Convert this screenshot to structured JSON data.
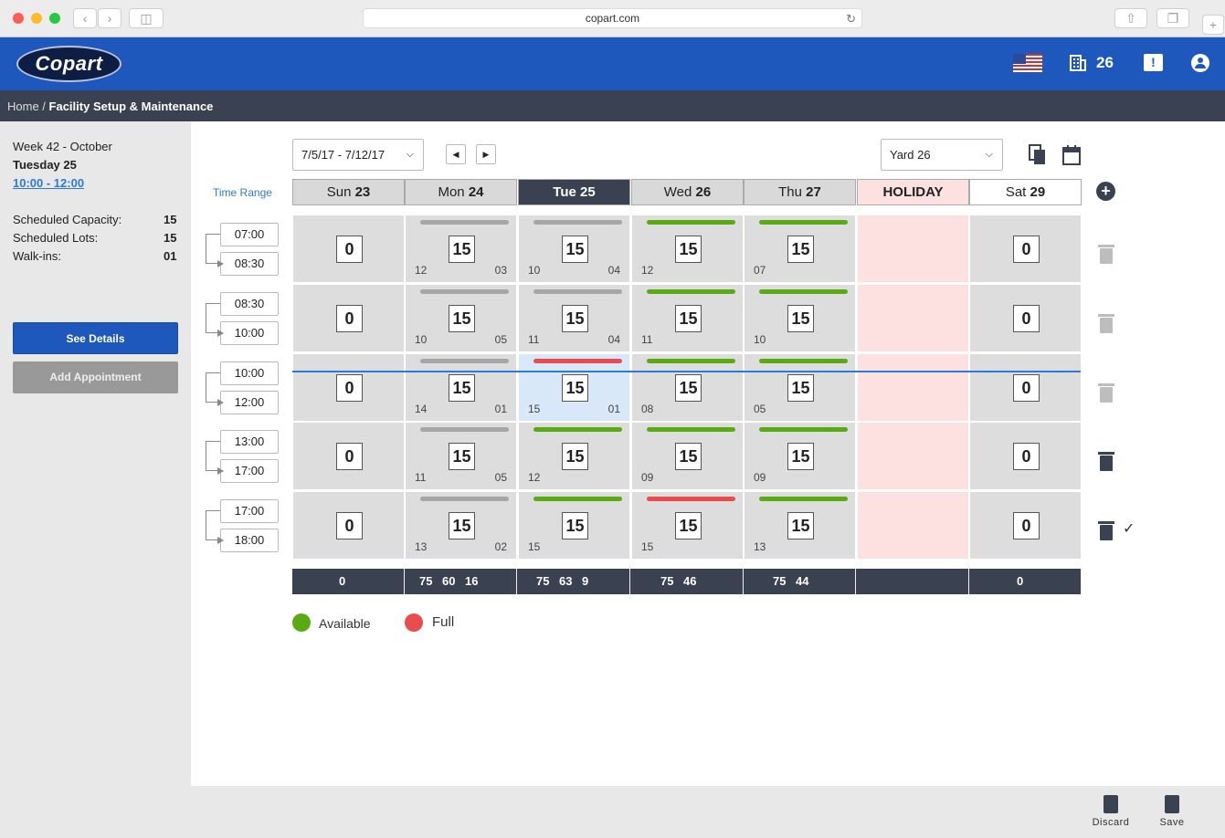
{
  "browser": {
    "url": "copart.com"
  },
  "header": {
    "logo": "Copart",
    "yard_count": "26"
  },
  "breadcrumb": {
    "home": "Home",
    "sep": " / ",
    "current": "Facility Setup & Maintenance"
  },
  "sidebar": {
    "week": "Week 42 - October",
    "day": "Tuesday 25",
    "range": "10:00 - 12:00",
    "stats": [
      {
        "label": "Scheduled Capacity:",
        "value": "15"
      },
      {
        "label": "Scheduled Lots:",
        "value": "15"
      },
      {
        "label": "Walk-ins:",
        "value": "01"
      }
    ],
    "see_details": "See Details",
    "add_appointment": "Add Appointment"
  },
  "toolbar": {
    "date_range": "7/5/17 - 7/12/17",
    "yard": "Yard 26",
    "time_range_label": "Time Range"
  },
  "days": [
    {
      "name": "Sun",
      "num": "23",
      "style": "normal"
    },
    {
      "name": "Mon",
      "num": "24",
      "style": "normal"
    },
    {
      "name": "Tue",
      "num": "25",
      "style": "selected"
    },
    {
      "name": "Wed",
      "num": "26",
      "style": "normal"
    },
    {
      "name": "Thu",
      "num": "27",
      "style": "normal"
    },
    {
      "name": "HOLIDAY",
      "num": "",
      "style": "holiday"
    },
    {
      "name": "Sat",
      "num": "29",
      "style": "white"
    }
  ],
  "slots": [
    {
      "start": "07:00",
      "end": "08:30",
      "trash": "light",
      "check": false,
      "cells": [
        {
          "cap": "0"
        },
        {
          "cap": "15",
          "bar": "grey",
          "l": "12",
          "r": "03"
        },
        {
          "cap": "15",
          "bar": "grey",
          "l": "10",
          "r": "04"
        },
        {
          "cap": "15",
          "bar": "green",
          "l": "12",
          "r": ""
        },
        {
          "cap": "15",
          "bar": "green",
          "l": "07",
          "r": ""
        },
        {
          "holiday": true
        },
        {
          "cap": "0"
        }
      ]
    },
    {
      "start": "08:30",
      "end": "10:00",
      "trash": "light",
      "check": false,
      "cells": [
        {
          "cap": "0"
        },
        {
          "cap": "15",
          "bar": "grey",
          "l": "10",
          "r": "05"
        },
        {
          "cap": "15",
          "bar": "grey",
          "l": "11",
          "r": "04"
        },
        {
          "cap": "15",
          "bar": "green",
          "l": "11",
          "r": ""
        },
        {
          "cap": "15",
          "bar": "green",
          "l": "10",
          "r": ""
        },
        {
          "holiday": true
        },
        {
          "cap": "0"
        }
      ]
    },
    {
      "start": "10:00",
      "end": "12:00",
      "trash": "light",
      "check": false,
      "cells": [
        {
          "cap": "0"
        },
        {
          "cap": "15",
          "bar": "grey",
          "l": "14",
          "r": "01"
        },
        {
          "cap": "15",
          "bar": "red",
          "l": "15",
          "r": "01",
          "hi": true
        },
        {
          "cap": "15",
          "bar": "green",
          "l": "08",
          "r": ""
        },
        {
          "cap": "15",
          "bar": "green",
          "l": "05",
          "r": ""
        },
        {
          "holiday": true
        },
        {
          "cap": "0"
        }
      ]
    },
    {
      "start": "13:00",
      "end": "17:00",
      "trash": "dark",
      "check": false,
      "cells": [
        {
          "cap": "0"
        },
        {
          "cap": "15",
          "bar": "grey",
          "l": "11",
          "r": "05"
        },
        {
          "cap": "15",
          "bar": "green",
          "l": "12",
          "r": ""
        },
        {
          "cap": "15",
          "bar": "green",
          "l": "09",
          "r": ""
        },
        {
          "cap": "15",
          "bar": "green",
          "l": "09",
          "r": ""
        },
        {
          "holiday": true
        },
        {
          "cap": "0"
        }
      ]
    },
    {
      "start": "17:00",
      "end": "18:00",
      "trash": "dark",
      "check": true,
      "cells": [
        {
          "cap": "0"
        },
        {
          "cap": "15",
          "bar": "grey",
          "l": "13",
          "r": "02"
        },
        {
          "cap": "15",
          "bar": "green",
          "l": "15",
          "r": ""
        },
        {
          "cap": "15",
          "bar": "red",
          "l": "15",
          "r": ""
        },
        {
          "cap": "15",
          "bar": "green",
          "l": "13",
          "r": ""
        },
        {
          "holiday": true
        },
        {
          "cap": "0"
        }
      ]
    }
  ],
  "totals": [
    [
      "0"
    ],
    [
      "75",
      "60",
      "16"
    ],
    [
      "75",
      "63",
      "9"
    ],
    [
      "75",
      "46"
    ],
    [
      "75",
      "44"
    ],
    [],
    [
      "0"
    ]
  ],
  "legend": {
    "available": "Available",
    "full": "Full"
  },
  "footer": {
    "discard": "Discard",
    "save": "Save"
  },
  "colors": {
    "brand": "#1f58bd",
    "dark": "#3a4150",
    "green": "#5aab13",
    "red": "#e84c4c",
    "grey": "#a6a6a6",
    "holiday": "#fde0e0"
  }
}
